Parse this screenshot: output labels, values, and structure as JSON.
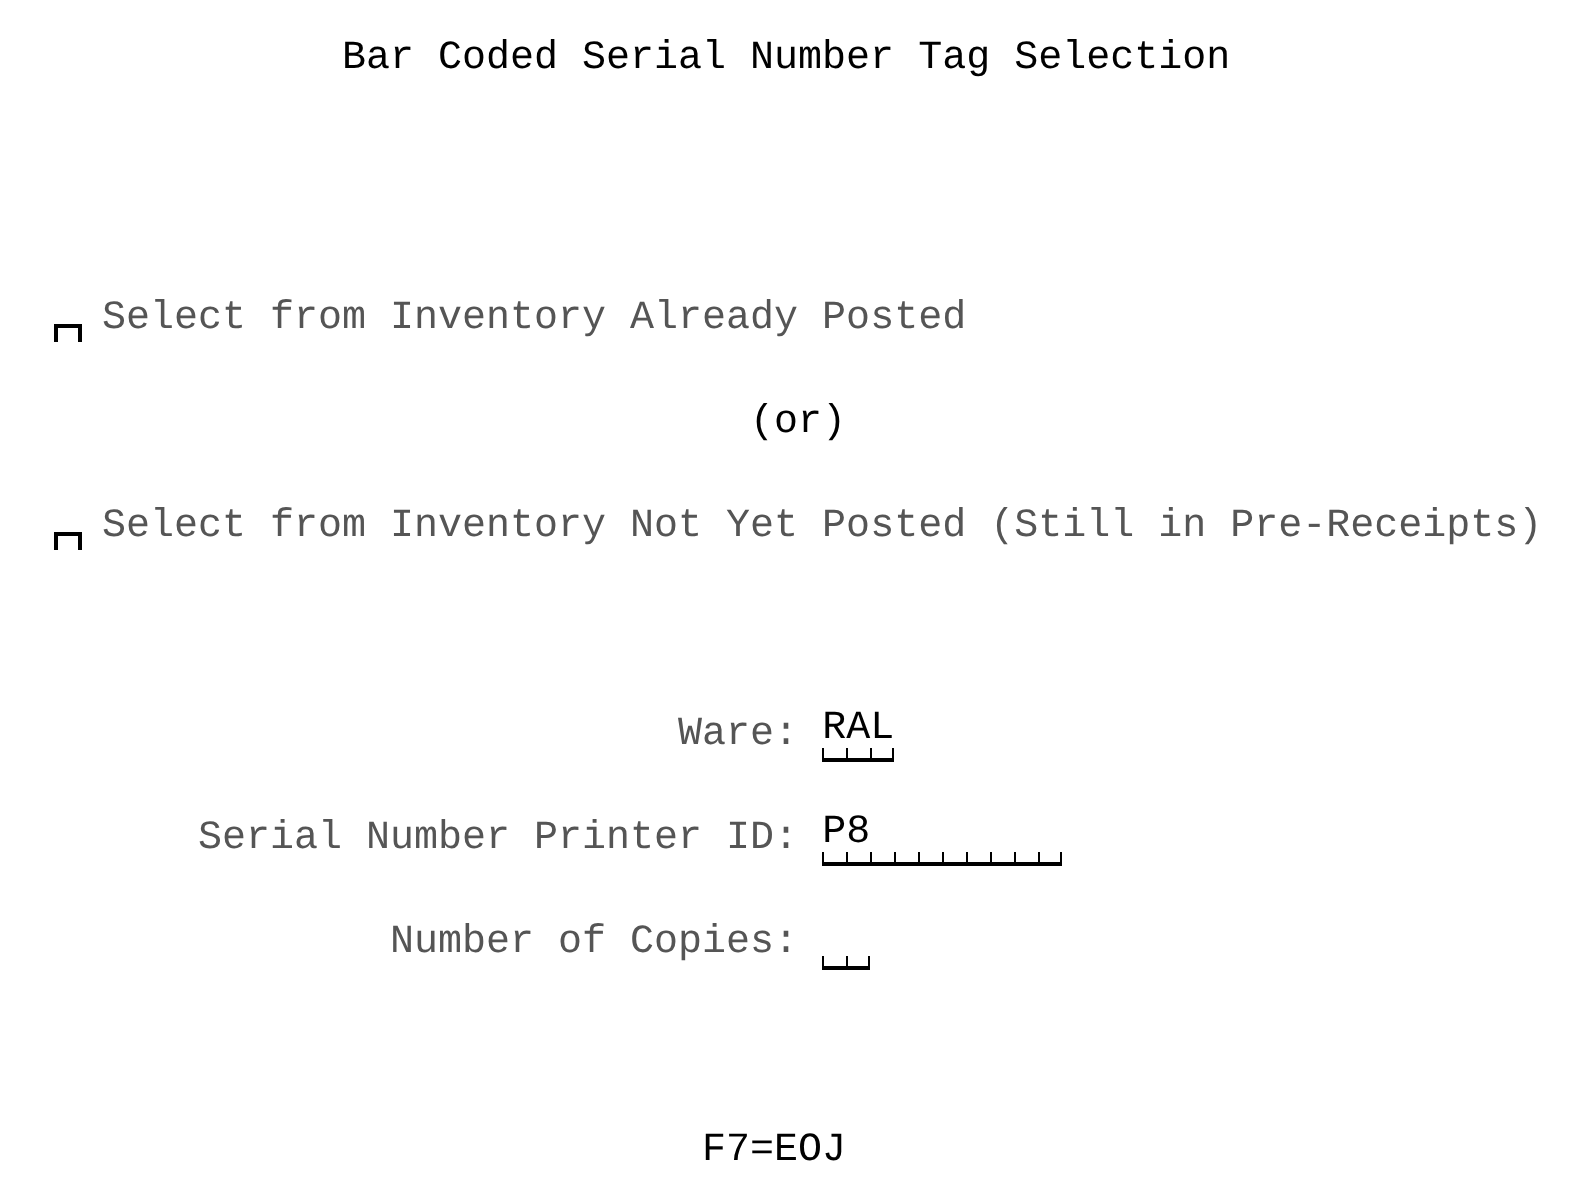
{
  "title": "Bar Coded Serial Number Tag Selection",
  "options": [
    {
      "label": "Select from Inventory Already Posted",
      "checked": false
    },
    {
      "label": "Select from Inventory Not Yet Posted (Still in Pre-Receipts)",
      "checked": false
    }
  ],
  "separator": "(or)",
  "fields": [
    {
      "label": "Ware:",
      "value": "RAL"
    },
    {
      "label": "Serial Number Printer ID:",
      "value": "P8"
    },
    {
      "label": "Number of Copies:"
    }
  ],
  "function_keys": "F7=EOJ"
}
